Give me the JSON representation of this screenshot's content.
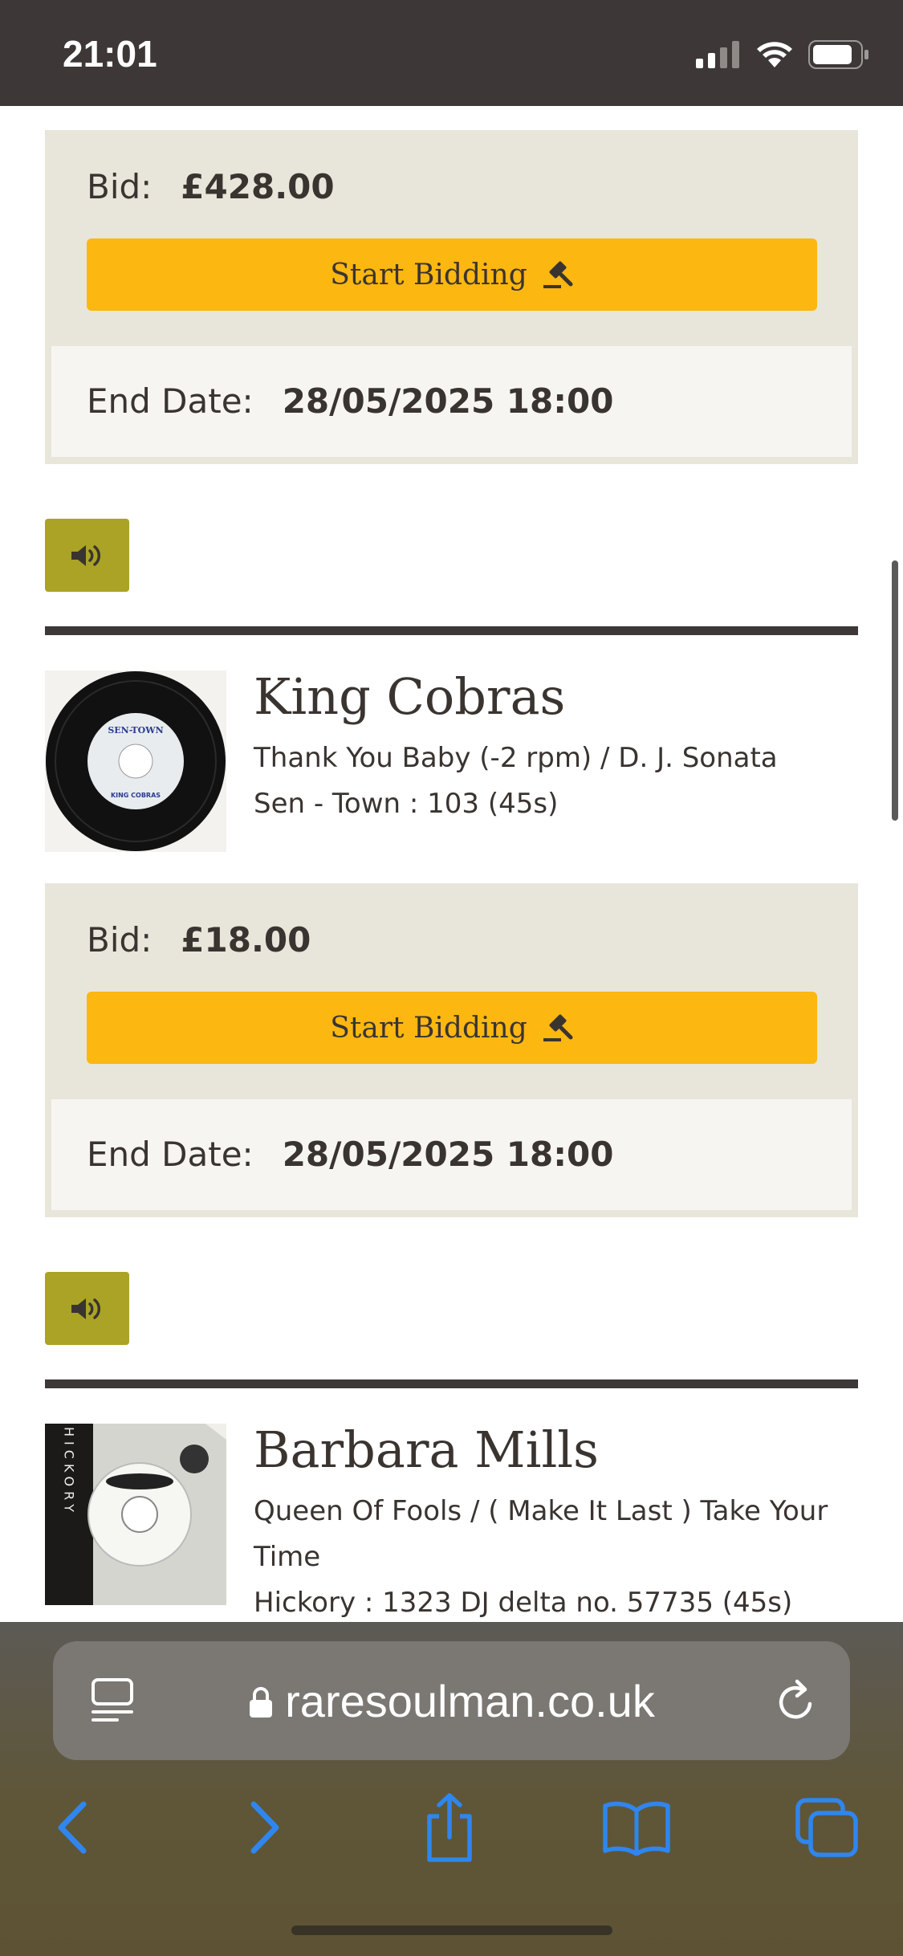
{
  "status_bar": {
    "time": "21:01"
  },
  "listings_top": {
    "bid_label": "Bid:",
    "bid_value": "£428.00",
    "button_label": "Start Bidding",
    "end_label": "End Date:",
    "end_value": "28/05/2025 18:00"
  },
  "records": [
    {
      "artist": "King Cobras",
      "title": "Thank You Baby (-2 rpm) / D. J. Sonata",
      "label": "Sen - Town : 103 (45s)",
      "bid_label": "Bid:",
      "bid_value": "£18.00",
      "button_label": "Start Bidding",
      "end_label": "End Date:",
      "end_value": "28/05/2025 18:00",
      "thumb_label_top": "SEN-TOWN",
      "thumb_label_bottom": "KING COBRAS"
    },
    {
      "artist": "Barbara Mills",
      "title": "Queen Of Fools / ( Make It Last ) Take Your Time",
      "label": "Hickory : 1323 DJ delta no. 57735 (45s)",
      "thumb_sleeve_text": "HICKORY"
    }
  ],
  "browser": {
    "url": "raresoulman.co.uk"
  },
  "icons": {
    "audio": "speaker-icon",
    "gavel": "gavel-icon",
    "reader": "reader-icon",
    "lock": "lock-icon",
    "reload": "reload-icon",
    "back": "back-icon",
    "forward": "forward-icon",
    "share": "share-icon",
    "bookmarks": "bookmarks-icon",
    "tabs": "tabs-icon"
  },
  "colors": {
    "bid_button": "#fcb711",
    "audio_button": "#aba325",
    "panel_bg": "#e8e6da",
    "ios_blue": "#2f86ee"
  }
}
